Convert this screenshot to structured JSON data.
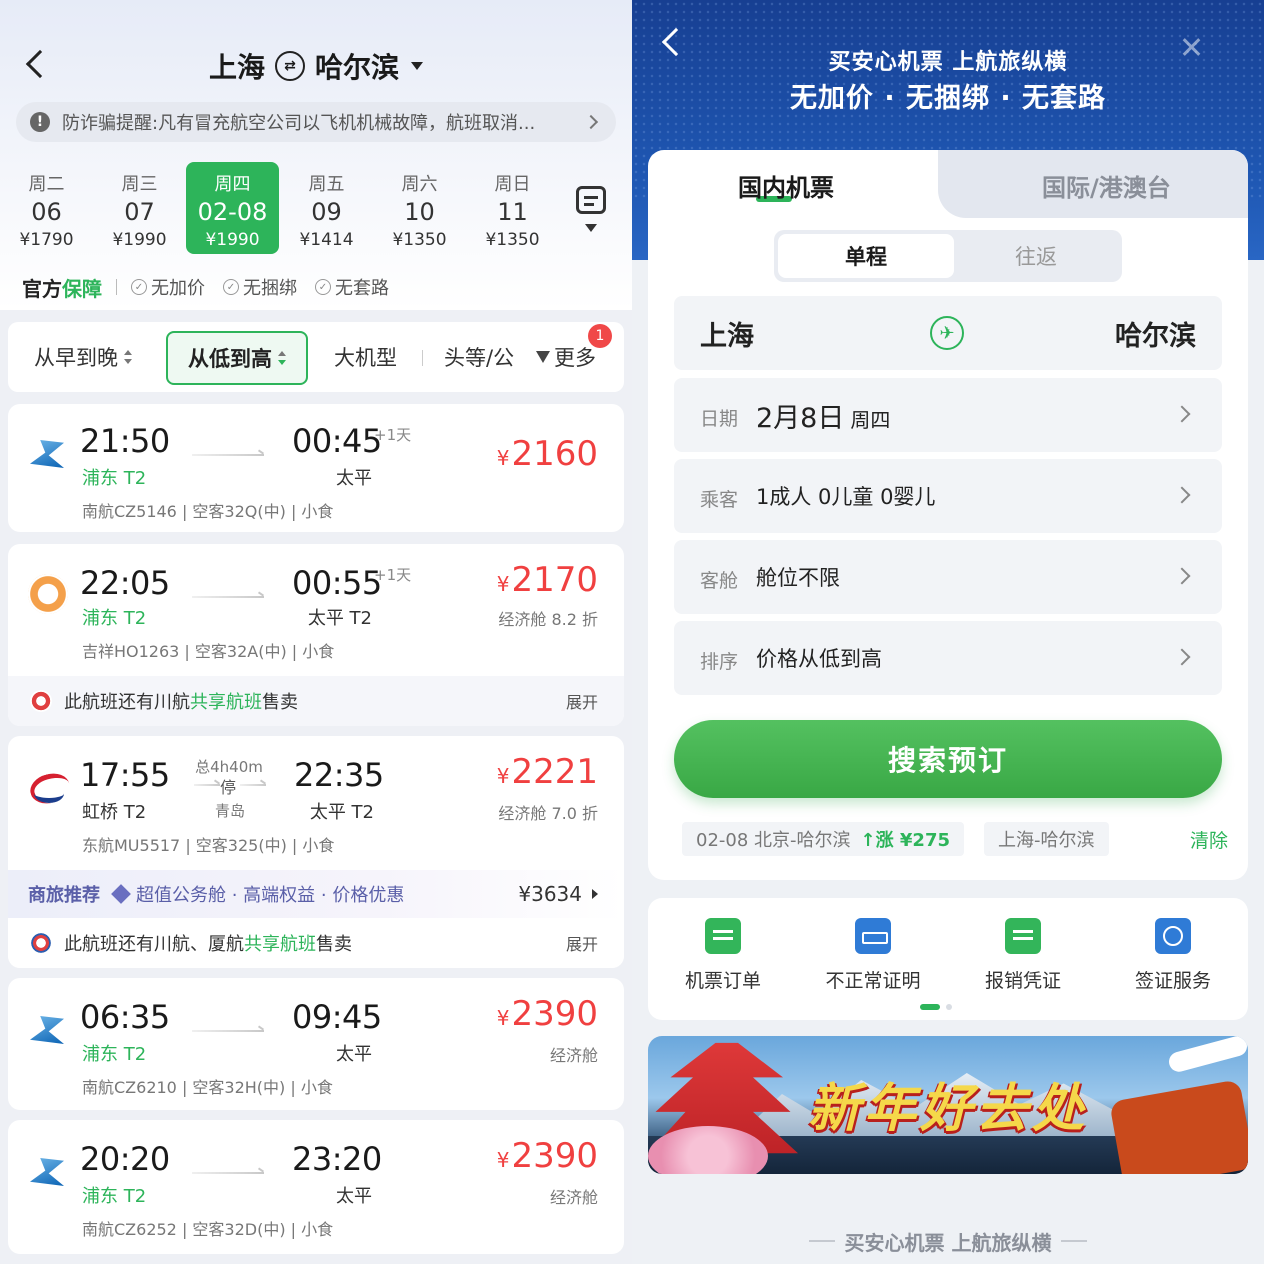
{
  "left": {
    "header": {
      "from": "上海",
      "to": "哈尔滨"
    },
    "notice": "防诈骗提醒:凡有冒充航空公司以飞机机械故障，航班取消...",
    "dates": [
      {
        "weekday": "周二",
        "date": "06",
        "price": "¥1790"
      },
      {
        "weekday": "周三",
        "date": "07",
        "price": "¥1990"
      },
      {
        "weekday": "周四",
        "date": "02-08",
        "price": "¥1990",
        "selected": true
      },
      {
        "weekday": "周五",
        "date": "09",
        "price": "¥1414"
      },
      {
        "weekday": "周六",
        "date": "10",
        "price": "¥1350"
      },
      {
        "weekday": "周日",
        "date": "11",
        "price": "¥1350"
      }
    ],
    "guarantee": {
      "title1": "官方",
      "title2": "保障",
      "items": [
        "无加价",
        "无捆绑",
        "无套路"
      ]
    },
    "sort": {
      "early": "从早到晚",
      "low": "从低到高",
      "big": "大机型",
      "first": "头等/公",
      "more": "更多",
      "more_badge": "1"
    },
    "flights": [
      {
        "dep_time": "21:50",
        "dep_airport": "浦东 T2",
        "arr_time": "00:45",
        "plus": "+1天",
        "arr_airport": "太平",
        "currency": "¥",
        "price": "2160",
        "subprice": "",
        "meta": "南航CZ5146 | 空客32Q(中) | 小食"
      },
      {
        "dep_time": "22:05",
        "dep_airport": "浦东 T2",
        "arr_time": "00:55",
        "plus": "+1天",
        "arr_airport": "太平 T2",
        "currency": "¥",
        "price": "2170",
        "subprice": "经济舱 8.2 折",
        "meta": "吉祥HO1263 | 空客32A(中) | 小食",
        "shared_pre": "此航班还有川航",
        "shared_green": "共享航班",
        "shared_post": "售卖",
        "expand": "展开"
      },
      {
        "dep_time": "17:55",
        "dep_airport": "虹桥 T2",
        "arr_time": "22:35",
        "arr_airport": "太平 T2",
        "duration": "总4h40m",
        "stop": "停",
        "stop_city": "青岛",
        "currency": "¥",
        "price": "2221",
        "subprice": "经济舱 7.0 折",
        "meta": "东航MU5517 | 空客325(中) | 小食",
        "biz_tag": "商旅推荐",
        "biz_desc": "超值公务舱 · 高端权益 · 价格优惠",
        "biz_price": "¥3634",
        "shared_pre": "此航班还有川航、厦航",
        "shared_green": "共享航班",
        "shared_post": "售卖",
        "expand": "展开"
      },
      {
        "dep_time": "06:35",
        "dep_airport": "浦东 T2",
        "arr_time": "09:45",
        "arr_airport": "太平",
        "currency": "¥",
        "price": "2390",
        "subprice": "经济舱",
        "meta": "南航CZ6210 | 空客32H(中) | 小食"
      },
      {
        "dep_time": "20:20",
        "dep_airport": "浦东 T2",
        "arr_time": "23:20",
        "arr_airport": "太平",
        "currency": "¥",
        "price": "2390",
        "subprice": "经济舱",
        "meta": "南航CZ6252 | 空客32D(中) | 小食"
      }
    ]
  },
  "right": {
    "hero": {
      "line1": "买安心机票 上航旅纵横",
      "line2": "无加价 · 无捆绑 · 无套路"
    },
    "tabs": {
      "domestic": "国内机票",
      "intl": "国际/港澳台"
    },
    "trip": {
      "one_way": "单程",
      "round": "往返"
    },
    "city": {
      "from": "上海",
      "to": "哈尔滨"
    },
    "fields": {
      "date_label": "日期",
      "date_value": "2月8日",
      "date_weekday": "周四",
      "pax_label": "乘客",
      "pax_value": "1成人 0儿童 0婴儿",
      "cabin_label": "客舱",
      "cabin_value": "舱位不限",
      "sort_label": "排序",
      "sort_value": "价格从低到高"
    },
    "search_button": "搜索预订",
    "history": [
      {
        "text": "02-08 北京-哈尔滨",
        "rise": "涨 ¥275"
      },
      {
        "text": "上海-哈尔滨"
      }
    ],
    "history_clear": "清除",
    "quick": [
      "机票订单",
      "不正常证明",
      "报销凭证",
      "签证服务"
    ],
    "banner_title": "新年好去处",
    "footer": "买安心机票 上航旅纵横"
  }
}
